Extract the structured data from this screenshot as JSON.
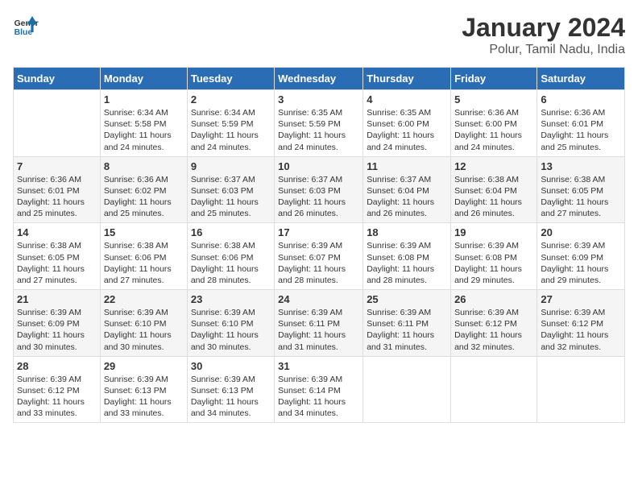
{
  "header": {
    "logo_line1": "General",
    "logo_line2": "Blue",
    "title": "January 2024",
    "subtitle": "Polur, Tamil Nadu, India"
  },
  "days_of_week": [
    "Sunday",
    "Monday",
    "Tuesday",
    "Wednesday",
    "Thursday",
    "Friday",
    "Saturday"
  ],
  "weeks": [
    [
      {
        "day": "",
        "info": ""
      },
      {
        "day": "1",
        "info": "Sunrise: 6:34 AM\nSunset: 5:58 PM\nDaylight: 11 hours\nand 24 minutes."
      },
      {
        "day": "2",
        "info": "Sunrise: 6:34 AM\nSunset: 5:59 PM\nDaylight: 11 hours\nand 24 minutes."
      },
      {
        "day": "3",
        "info": "Sunrise: 6:35 AM\nSunset: 5:59 PM\nDaylight: 11 hours\nand 24 minutes."
      },
      {
        "day": "4",
        "info": "Sunrise: 6:35 AM\nSunset: 6:00 PM\nDaylight: 11 hours\nand 24 minutes."
      },
      {
        "day": "5",
        "info": "Sunrise: 6:36 AM\nSunset: 6:00 PM\nDaylight: 11 hours\nand 24 minutes."
      },
      {
        "day": "6",
        "info": "Sunrise: 6:36 AM\nSunset: 6:01 PM\nDaylight: 11 hours\nand 25 minutes."
      }
    ],
    [
      {
        "day": "7",
        "info": "Sunrise: 6:36 AM\nSunset: 6:01 PM\nDaylight: 11 hours\nand 25 minutes."
      },
      {
        "day": "8",
        "info": "Sunrise: 6:36 AM\nSunset: 6:02 PM\nDaylight: 11 hours\nand 25 minutes."
      },
      {
        "day": "9",
        "info": "Sunrise: 6:37 AM\nSunset: 6:03 PM\nDaylight: 11 hours\nand 25 minutes."
      },
      {
        "day": "10",
        "info": "Sunrise: 6:37 AM\nSunset: 6:03 PM\nDaylight: 11 hours\nand 26 minutes."
      },
      {
        "day": "11",
        "info": "Sunrise: 6:37 AM\nSunset: 6:04 PM\nDaylight: 11 hours\nand 26 minutes."
      },
      {
        "day": "12",
        "info": "Sunrise: 6:38 AM\nSunset: 6:04 PM\nDaylight: 11 hours\nand 26 minutes."
      },
      {
        "day": "13",
        "info": "Sunrise: 6:38 AM\nSunset: 6:05 PM\nDaylight: 11 hours\nand 27 minutes."
      }
    ],
    [
      {
        "day": "14",
        "info": "Sunrise: 6:38 AM\nSunset: 6:05 PM\nDaylight: 11 hours\nand 27 minutes."
      },
      {
        "day": "15",
        "info": "Sunrise: 6:38 AM\nSunset: 6:06 PM\nDaylight: 11 hours\nand 27 minutes."
      },
      {
        "day": "16",
        "info": "Sunrise: 6:38 AM\nSunset: 6:06 PM\nDaylight: 11 hours\nand 28 minutes."
      },
      {
        "day": "17",
        "info": "Sunrise: 6:39 AM\nSunset: 6:07 PM\nDaylight: 11 hours\nand 28 minutes."
      },
      {
        "day": "18",
        "info": "Sunrise: 6:39 AM\nSunset: 6:08 PM\nDaylight: 11 hours\nand 28 minutes."
      },
      {
        "day": "19",
        "info": "Sunrise: 6:39 AM\nSunset: 6:08 PM\nDaylight: 11 hours\nand 29 minutes."
      },
      {
        "day": "20",
        "info": "Sunrise: 6:39 AM\nSunset: 6:09 PM\nDaylight: 11 hours\nand 29 minutes."
      }
    ],
    [
      {
        "day": "21",
        "info": "Sunrise: 6:39 AM\nSunset: 6:09 PM\nDaylight: 11 hours\nand 30 minutes."
      },
      {
        "day": "22",
        "info": "Sunrise: 6:39 AM\nSunset: 6:10 PM\nDaylight: 11 hours\nand 30 minutes."
      },
      {
        "day": "23",
        "info": "Sunrise: 6:39 AM\nSunset: 6:10 PM\nDaylight: 11 hours\nand 30 minutes."
      },
      {
        "day": "24",
        "info": "Sunrise: 6:39 AM\nSunset: 6:11 PM\nDaylight: 11 hours\nand 31 minutes."
      },
      {
        "day": "25",
        "info": "Sunrise: 6:39 AM\nSunset: 6:11 PM\nDaylight: 11 hours\nand 31 minutes."
      },
      {
        "day": "26",
        "info": "Sunrise: 6:39 AM\nSunset: 6:12 PM\nDaylight: 11 hours\nand 32 minutes."
      },
      {
        "day": "27",
        "info": "Sunrise: 6:39 AM\nSunset: 6:12 PM\nDaylight: 11 hours\nand 32 minutes."
      }
    ],
    [
      {
        "day": "28",
        "info": "Sunrise: 6:39 AM\nSunset: 6:12 PM\nDaylight: 11 hours\nand 33 minutes."
      },
      {
        "day": "29",
        "info": "Sunrise: 6:39 AM\nSunset: 6:13 PM\nDaylight: 11 hours\nand 33 minutes."
      },
      {
        "day": "30",
        "info": "Sunrise: 6:39 AM\nSunset: 6:13 PM\nDaylight: 11 hours\nand 34 minutes."
      },
      {
        "day": "31",
        "info": "Sunrise: 6:39 AM\nSunset: 6:14 PM\nDaylight: 11 hours\nand 34 minutes."
      },
      {
        "day": "",
        "info": ""
      },
      {
        "day": "",
        "info": ""
      },
      {
        "day": "",
        "info": ""
      }
    ]
  ]
}
